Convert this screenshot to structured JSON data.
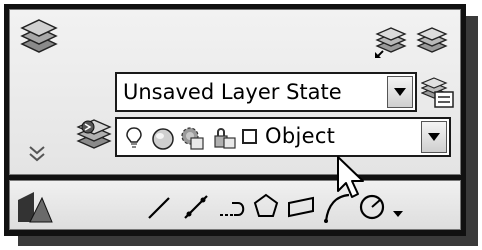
{
  "layer_state": {
    "combo_value": "Unsaved Layer State",
    "icon": "layer-state-manager-icon"
  },
  "layer_combo": {
    "layer_name": "Object",
    "status_icons": [
      "lightbulb-on-icon",
      "sun-freeze-icon",
      "viewport-freeze-icon",
      "lock-icon",
      "color-swatch-icon"
    ]
  },
  "left_icons": [
    "layer-properties-icon",
    "expand-chevron-icon",
    "draw-panel-icon"
  ],
  "top_right_icons": [
    "make-current-layer-icon",
    "match-layer-icon"
  ],
  "layer_make_current_icon": "set-current-layer-icon",
  "draw_tools": [
    "line-icon",
    "construction-line-icon",
    "polyline-icon",
    "polygon-icon",
    "rectangle-icon",
    "arc-icon",
    "circle-icon",
    "more-dropdown-icon"
  ],
  "cursor": "mouse-pointer-icon"
}
